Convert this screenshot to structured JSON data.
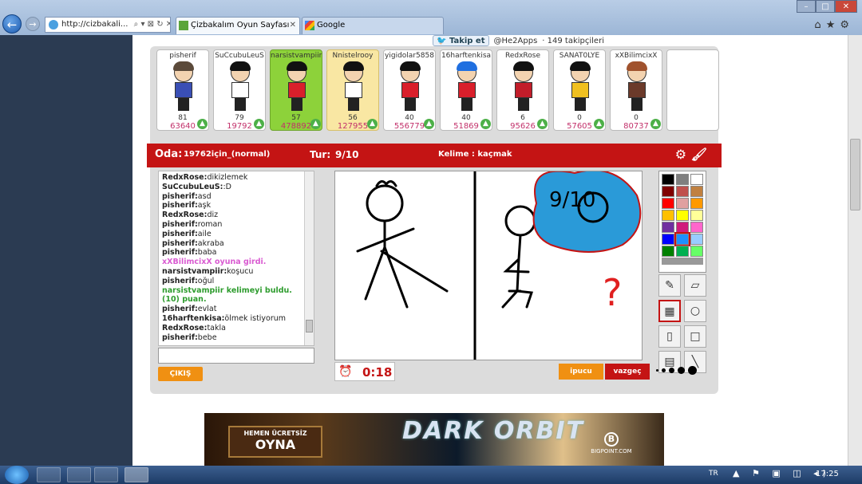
{
  "browser": {
    "address": "http://cizbakali...",
    "address_tools": "⌕ ▾ ⊠ ↻ ✕",
    "tabs": [
      {
        "label": "Çizbakalım Oyun Sayfası",
        "active": true
      },
      {
        "label": "Google",
        "active": false
      }
    ],
    "window_controls": [
      "–",
      "□",
      "✕"
    ],
    "toolbar_icons": [
      "home-icon",
      "star-icon",
      "gear-icon"
    ]
  },
  "social": {
    "follow_label": "Takip et",
    "handle": "@He2Apps",
    "followers": "· 149 takipçileri"
  },
  "players": [
    {
      "name": "pisherif",
      "guesses": "81",
      "score": "63640",
      "state": "normal",
      "hair": "#5b4a3a",
      "shirt": "#3a4fb5"
    },
    {
      "name": "SuCcubuLeuS",
      "guesses": "79",
      "score": "19792",
      "state": "normal",
      "hair": "#111111",
      "shirt": "#ffffff"
    },
    {
      "name": "narsistvampiir",
      "guesses": "57",
      "score": "478892",
      "state": "drawer",
      "hair": "#111111",
      "shirt": "#d91f2b"
    },
    {
      "name": "Nnistelrooy",
      "guesses": "56",
      "score": "127955",
      "state": "guessed",
      "hair": "#111111",
      "shirt": "#ffffff"
    },
    {
      "name": "yigidolar5858",
      "guesses": "40",
      "score": "556779",
      "state": "normal",
      "hair": "#111111",
      "shirt": "#d91f2b"
    },
    {
      "name": "16harftenkisa",
      "guesses": "40",
      "score": "51869",
      "state": "normal",
      "hair": "#1f6fe0",
      "shirt": "#d91f2b"
    },
    {
      "name": "RedxRose",
      "guesses": "6",
      "score": "95626",
      "state": "normal",
      "hair": "#111111",
      "shirt": "#c21d2a"
    },
    {
      "name": "SANAT0LYE",
      "guesses": "0",
      "score": "57605",
      "state": "normal",
      "hair": "#111111",
      "shirt": "#f0c020"
    },
    {
      "name": "xXBilimcixX",
      "guesses": "0",
      "score": "80737",
      "state": "normal",
      "hair": "#a0522d",
      "shirt": "#6b3a2a"
    }
  ],
  "room": {
    "oda_label": "Oda:",
    "oda_value": "19762için_(normal)",
    "tur_label": "Tur:",
    "tur_value": "9/10",
    "kelime": "Kelime : kaçmak"
  },
  "chat": [
    {
      "user": "RedxRose:",
      "text": "dikizlemek",
      "type": "msg"
    },
    {
      "user": "SuCcubuLeuS:",
      "text": ":D",
      "type": "msg"
    },
    {
      "user": "pisherif:",
      "text": "asd",
      "type": "msg"
    },
    {
      "user": "pisherif:",
      "text": "aşk",
      "type": "msg"
    },
    {
      "user": "RedxRose:",
      "text": "diz",
      "type": "msg"
    },
    {
      "user": "pisherif:",
      "text": "roman",
      "type": "msg"
    },
    {
      "user": "pisherif:",
      "text": "aile",
      "type": "msg"
    },
    {
      "user": "pisherif:",
      "text": "akraba",
      "type": "msg"
    },
    {
      "user": "pisherif:",
      "text": "baba",
      "type": "msg"
    },
    {
      "user": "",
      "text": "xXBilimcixX oyuna girdi.",
      "type": "pink"
    },
    {
      "user": "narsistvampiir:",
      "text": "koşucu",
      "type": "msg"
    },
    {
      "user": "pisherif:",
      "text": "oğul",
      "type": "msg"
    },
    {
      "user": "",
      "text": "narsistvampiir kelimeyi buldu.",
      "type": "green"
    },
    {
      "user": "",
      "text": "(10) puan.",
      "type": "green"
    },
    {
      "user": "pisherif:",
      "text": "evlat",
      "type": "msg"
    },
    {
      "user": "16harftenkisa:",
      "text": "ölmek istiyorum",
      "type": "msg"
    },
    {
      "user": "RedxRose:",
      "text": "takla",
      "type": "msg"
    },
    {
      "user": "pisherif:",
      "text": "bebe",
      "type": "msg"
    }
  ],
  "buttons": {
    "cikis": "ÇIKIŞ",
    "ipucu": "ipucu",
    "vazgec": "vazgeç"
  },
  "timer": "0:18",
  "canvas_text": {
    "bubble": "9/10",
    "question": "?"
  },
  "palette_colors": [
    "#000000",
    "#7f7f7f",
    "#ffffff",
    "#7f0000",
    "#c0504d",
    "#c08040",
    "#ff0000",
    "#e0a0a0",
    "#ff9900",
    "#ffc000",
    "#ffff00",
    "#ffff99",
    "#7030a0",
    "#d01c7c",
    "#ff66cc",
    "#0000ff",
    "#1e90ff",
    "#99ccff",
    "#008000",
    "#00b050",
    "#66ff66"
  ],
  "selected_color": "#1e90ff",
  "tools": [
    {
      "icon": "pencil-icon",
      "glyph": "✎"
    },
    {
      "icon": "eraser-icon",
      "glyph": "▱"
    },
    {
      "icon": "fill-icon",
      "glyph": "▦"
    },
    {
      "icon": "circle-icon",
      "glyph": "○"
    },
    {
      "icon": "bucket-icon",
      "glyph": "▯"
    },
    {
      "icon": "square-icon",
      "glyph": "□"
    },
    {
      "icon": "easel-icon",
      "glyph": "▤"
    },
    {
      "icon": "line-icon",
      "glyph": "╲"
    }
  ],
  "ad": {
    "btn_line1": "HEMEN ÜCRETSİZ",
    "btn_line2": "OYNA",
    "logo": "DARK ORBIT",
    "brand": "BIGPOINT.COM",
    "brand_letter": "B"
  },
  "taskbar": {
    "lang": "TR",
    "tray_icons": "▲ ⚑ ▣ ◫ ◂)",
    "time": "17:25"
  }
}
